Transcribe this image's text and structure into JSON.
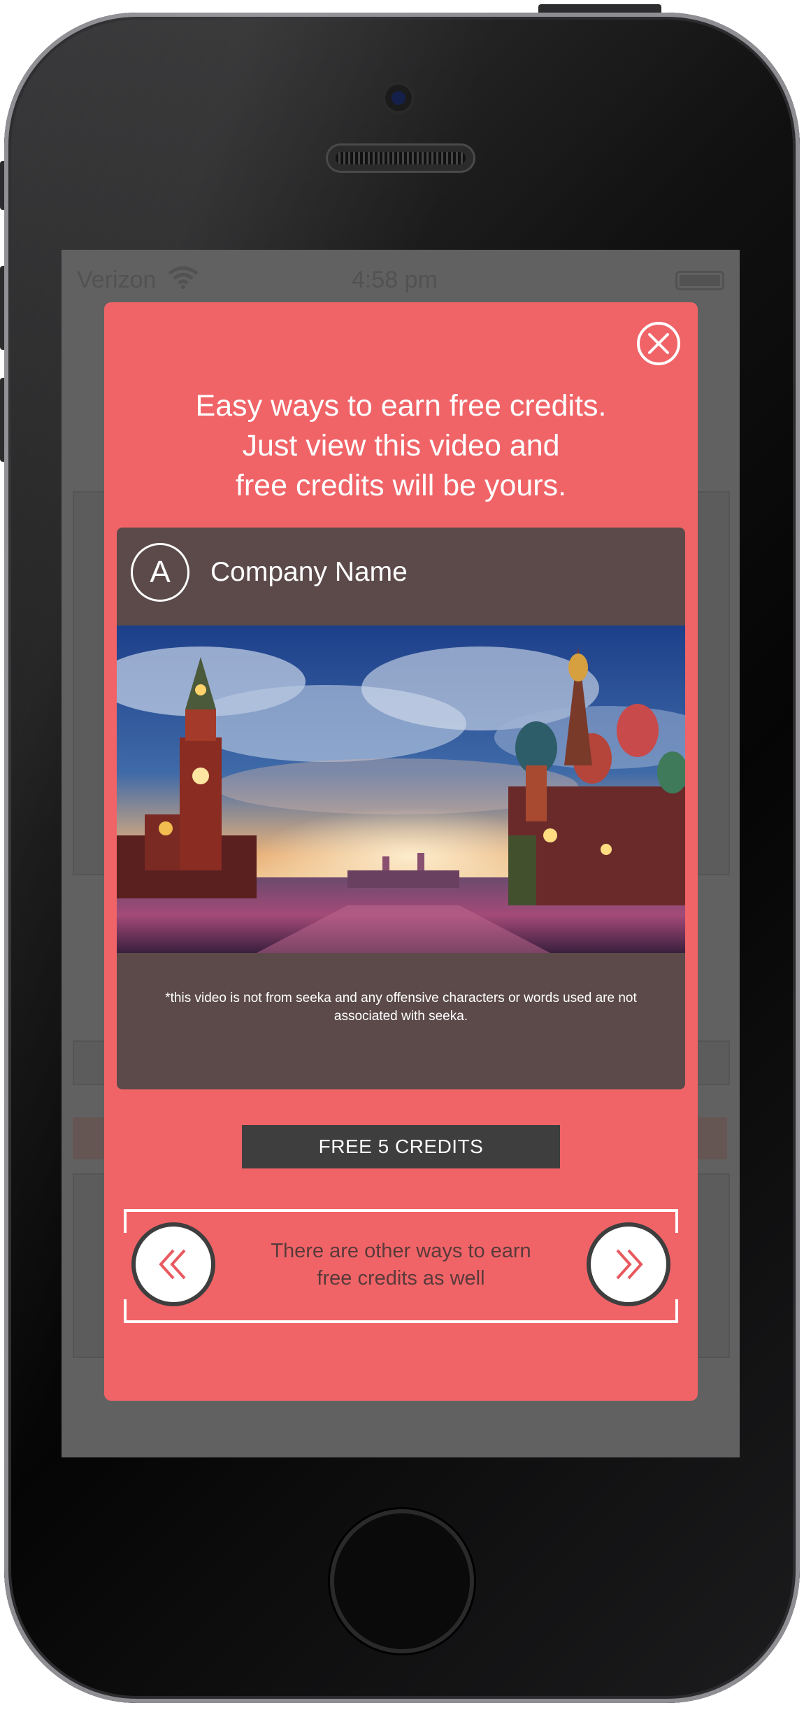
{
  "status_bar": {
    "carrier": "Verizon",
    "time": "4:58 pm"
  },
  "modal": {
    "headline": "Easy ways to earn free credits.\nJust view this video and\nfree credits will be yours.",
    "company": {
      "avatar_letter": "A",
      "name": "Company Name"
    },
    "disclaimer": "*this video is not from seeka and any offensive characters or words used are not associated with seeka.",
    "credits_button": "FREE 5 CREDITS",
    "other_ways_text": "There are other ways to earn\nfree credits as well"
  },
  "colors": {
    "modal_bg": "#f06468",
    "card_bg": "#5c4a4a",
    "button_bg": "#3e3e3e"
  },
  "icons": [
    "close-icon",
    "double-chevron-left-icon",
    "double-chevron-right-icon",
    "wifi-icon",
    "battery-icon"
  ]
}
